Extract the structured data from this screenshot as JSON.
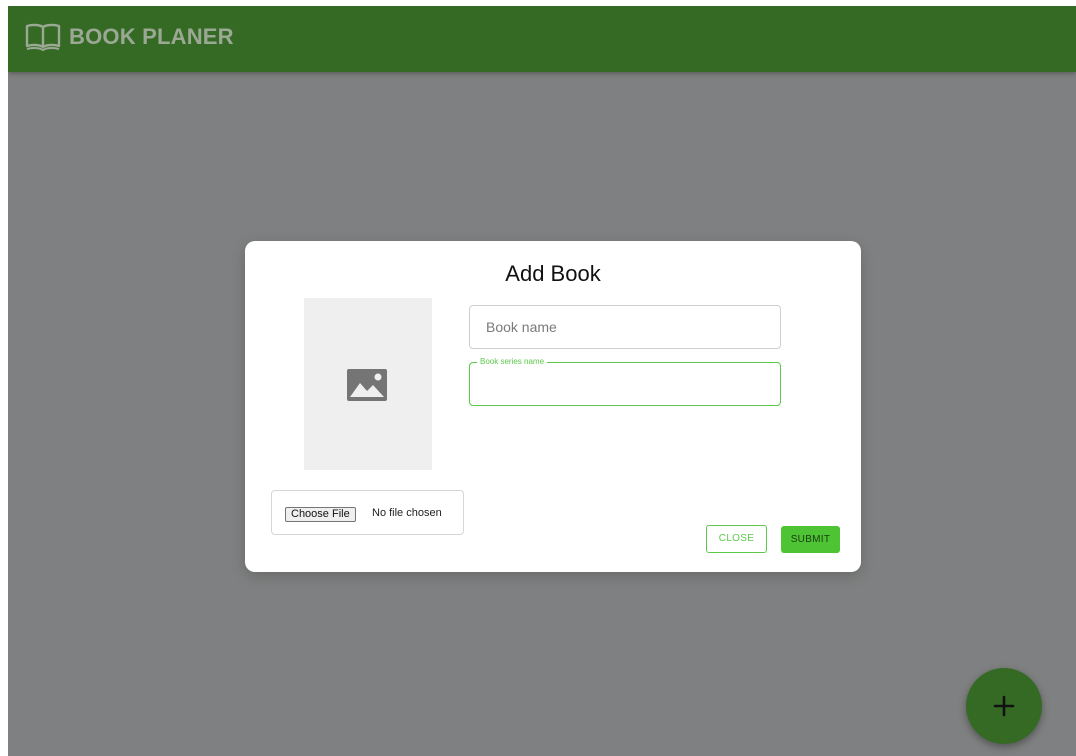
{
  "app": {
    "title": "BOOK PLANER",
    "logo_icon": "open-book-icon",
    "bar_color": "#356a25",
    "backdrop_color": "#7f8081"
  },
  "dialog": {
    "title": "Add Book",
    "image_placeholder_icon": "image-icon",
    "file_input": {
      "button_label": "Choose File",
      "status": "No file chosen"
    },
    "book_name": {
      "placeholder": "Book name",
      "value": ""
    },
    "book_series": {
      "label": "Book series name",
      "value": ""
    },
    "close_label": "CLOSE",
    "submit_label": "SUBMIT",
    "accent_color": "#5cc84a"
  },
  "fab": {
    "icon": "plus-icon"
  }
}
